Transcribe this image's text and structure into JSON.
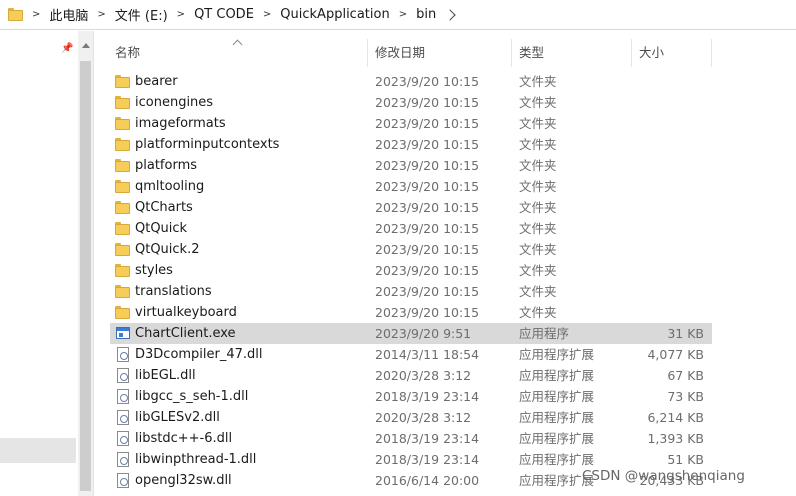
{
  "breadcrumb": {
    "folder_icon": "folder-icon",
    "items": [
      "此电脑",
      "文件 (E:)",
      "QT CODE",
      "QuickApplication",
      "bin"
    ],
    "separator": ">"
  },
  "columns": {
    "name": "名称",
    "date": "修改日期",
    "type": "类型",
    "size": "大小"
  },
  "files": [
    {
      "name": "bearer",
      "date": "2023/9/20 10:15",
      "type": "文件夹",
      "size": "",
      "icon": "folder-icon",
      "selected": false
    },
    {
      "name": "iconengines",
      "date": "2023/9/20 10:15",
      "type": "文件夹",
      "size": "",
      "icon": "folder-icon",
      "selected": false
    },
    {
      "name": "imageformats",
      "date": "2023/9/20 10:15",
      "type": "文件夹",
      "size": "",
      "icon": "folder-icon",
      "selected": false
    },
    {
      "name": "platforminputcontexts",
      "date": "2023/9/20 10:15",
      "type": "文件夹",
      "size": "",
      "icon": "folder-icon",
      "selected": false
    },
    {
      "name": "platforms",
      "date": "2023/9/20 10:15",
      "type": "文件夹",
      "size": "",
      "icon": "folder-icon",
      "selected": false
    },
    {
      "name": "qmltooling",
      "date": "2023/9/20 10:15",
      "type": "文件夹",
      "size": "",
      "icon": "folder-icon",
      "selected": false
    },
    {
      "name": "QtCharts",
      "date": "2023/9/20 10:15",
      "type": "文件夹",
      "size": "",
      "icon": "folder-icon",
      "selected": false
    },
    {
      "name": "QtQuick",
      "date": "2023/9/20 10:15",
      "type": "文件夹",
      "size": "",
      "icon": "folder-icon",
      "selected": false
    },
    {
      "name": "QtQuick.2",
      "date": "2023/9/20 10:15",
      "type": "文件夹",
      "size": "",
      "icon": "folder-icon",
      "selected": false
    },
    {
      "name": "styles",
      "date": "2023/9/20 10:15",
      "type": "文件夹",
      "size": "",
      "icon": "folder-icon",
      "selected": false
    },
    {
      "name": "translations",
      "date": "2023/9/20 10:15",
      "type": "文件夹",
      "size": "",
      "icon": "folder-icon",
      "selected": false
    },
    {
      "name": "virtualkeyboard",
      "date": "2023/9/20 10:15",
      "type": "文件夹",
      "size": "",
      "icon": "folder-icon",
      "selected": false
    },
    {
      "name": "ChartClient.exe",
      "date": "2023/9/20 9:51",
      "type": "应用程序",
      "size": "31 KB",
      "icon": "exe-icon",
      "selected": true
    },
    {
      "name": "D3Dcompiler_47.dll",
      "date": "2014/3/11 18:54",
      "type": "应用程序扩展",
      "size": "4,077 KB",
      "icon": "dll-icon",
      "selected": false
    },
    {
      "name": "libEGL.dll",
      "date": "2020/3/28 3:12",
      "type": "应用程序扩展",
      "size": "67 KB",
      "icon": "dll-icon",
      "selected": false
    },
    {
      "name": "libgcc_s_seh-1.dll",
      "date": "2018/3/19 23:14",
      "type": "应用程序扩展",
      "size": "73 KB",
      "icon": "dll-icon",
      "selected": false
    },
    {
      "name": "libGLESv2.dll",
      "date": "2020/3/28 3:12",
      "type": "应用程序扩展",
      "size": "6,214 KB",
      "icon": "dll-icon",
      "selected": false
    },
    {
      "name": "libstdc++-6.dll",
      "date": "2018/3/19 23:14",
      "type": "应用程序扩展",
      "size": "1,393 KB",
      "icon": "dll-icon",
      "selected": false
    },
    {
      "name": "libwinpthread-1.dll",
      "date": "2018/3/19 23:14",
      "type": "应用程序扩展",
      "size": "51 KB",
      "icon": "dll-icon",
      "selected": false
    },
    {
      "name": "opengl32sw.dll",
      "date": "2016/6/14 20:00",
      "type": "应用程序扩展",
      "size": "20,433 KB",
      "icon": "dll-icon",
      "selected": false
    }
  ],
  "watermark": "CSDN @wangshenqiang",
  "colors": {
    "selection": "#d9d9d9",
    "folder": "#f6cd59",
    "secondary_text": "#6d6d6d"
  }
}
